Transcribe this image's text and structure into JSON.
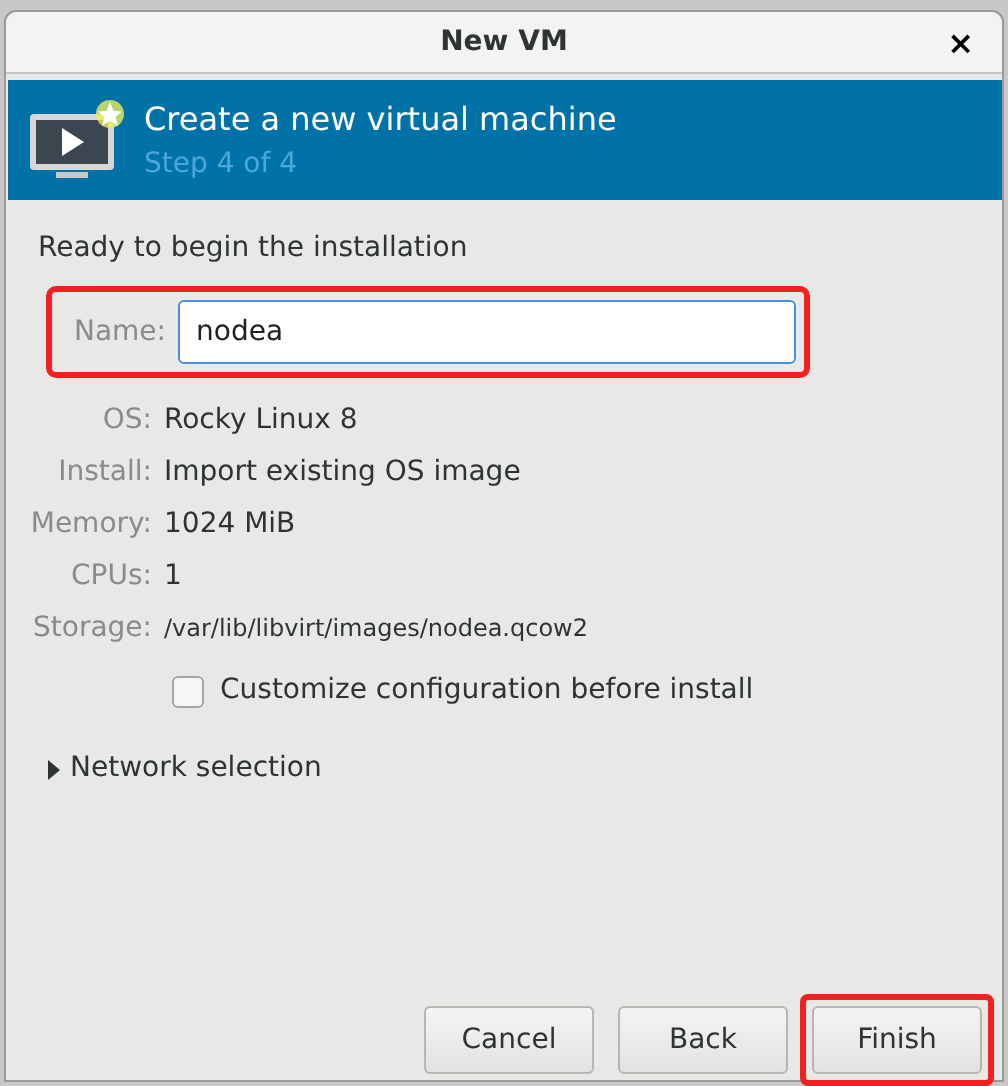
{
  "window": {
    "title": "New VM",
    "close": "×"
  },
  "banner": {
    "title": "Create a new virtual machine",
    "subtitle": "Step 4 of 4"
  },
  "heading": "Ready to begin the installation",
  "name_field": {
    "label": "Name:",
    "value": "nodea",
    "highlighted": true
  },
  "details": [
    {
      "label": "OS:",
      "value": "Rocky Linux 8",
      "kind": "normal"
    },
    {
      "label": "Install:",
      "value": "Import existing OS image",
      "kind": "normal"
    },
    {
      "label": "Memory:",
      "value": "1024 MiB",
      "kind": "normal"
    },
    {
      "label": "CPUs:",
      "value": "1",
      "kind": "normal"
    },
    {
      "label": "Storage:",
      "value": "/var/lib/libvirt/images/nodea.qcow2",
      "kind": "small"
    }
  ],
  "customize": {
    "label": "Customize configuration before install",
    "checked": false
  },
  "network": {
    "label": "Network selection",
    "expanded": false
  },
  "buttons": [
    {
      "label": "Cancel",
      "highlighted": false
    },
    {
      "label": "Back",
      "highlighted": false
    },
    {
      "label": "Finish",
      "highlighted": true
    }
  ]
}
